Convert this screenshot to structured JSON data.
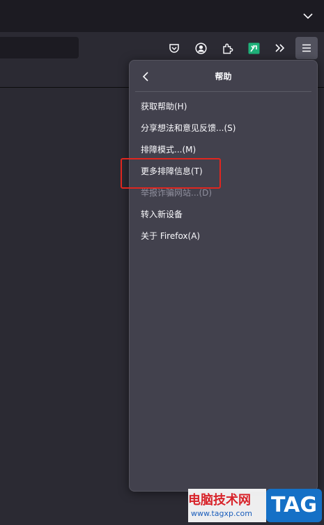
{
  "panel": {
    "title": "帮助",
    "items": [
      {
        "label": "获取帮助(H)",
        "disabled": false
      },
      {
        "label": "分享想法和意见反馈...(S)",
        "disabled": false
      },
      {
        "label": "排障模式...(M)",
        "disabled": false
      },
      {
        "label": "更多排障信息(T)",
        "disabled": false
      },
      {
        "label": "举报诈骗网站...(D)",
        "disabled": true
      },
      {
        "label": "转入新设备",
        "disabled": false
      },
      {
        "label": "关于 Firefox(A)",
        "disabled": false
      }
    ]
  },
  "toolbar": {
    "icons": [
      "pocket-icon",
      "account-icon",
      "extensions-icon",
      "extension-green-icon",
      "overflow-chevron-icon",
      "menu-hamburger-icon"
    ]
  },
  "watermark": {
    "site_name": "电脑技术网",
    "url": "www.tagxp.com",
    "badge": "TAG"
  },
  "colors": {
    "highlight": "#e0261f",
    "panel_bg": "#42414d",
    "menu_active_bg": "#52525e"
  }
}
